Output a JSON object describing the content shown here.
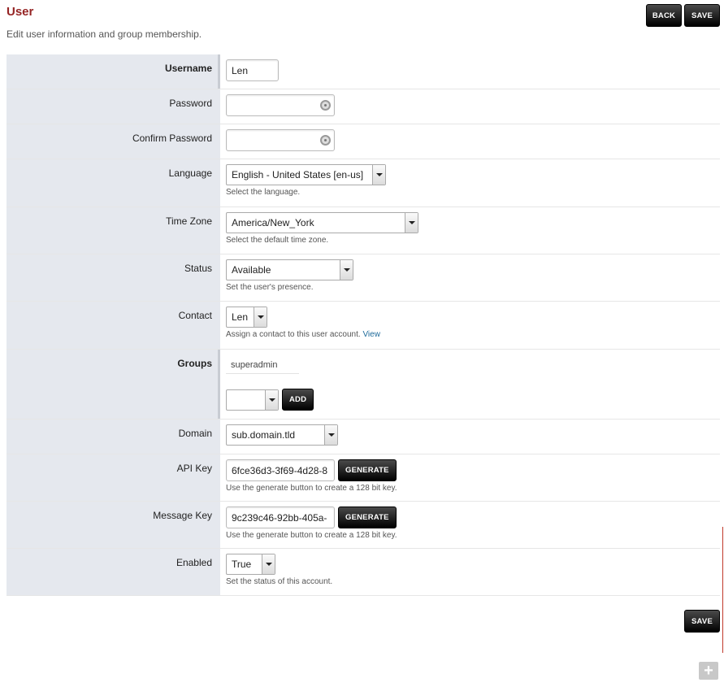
{
  "page": {
    "title": "User",
    "description": "Edit user information and group membership."
  },
  "buttons": {
    "back": "BACK",
    "save": "SAVE",
    "generate": "GENERATE",
    "add": "ADD"
  },
  "form": {
    "username": {
      "label": "Username",
      "value": "Len"
    },
    "password": {
      "label": "Password",
      "value": ""
    },
    "confirm_password": {
      "label": "Confirm Password",
      "value": ""
    },
    "language": {
      "label": "Language",
      "value": "English - United States [en-us]",
      "hint": "Select the language."
    },
    "time_zone": {
      "label": "Time Zone",
      "value": "America/New_York",
      "hint": "Select the default time zone."
    },
    "status": {
      "label": "Status",
      "value": "Available",
      "hint": "Set the user's presence."
    },
    "contact": {
      "label": "Contact",
      "value": "Len",
      "hint": "Assign a contact to this user account.",
      "link": "View"
    },
    "groups": {
      "label": "Groups",
      "items": [
        "superadmin"
      ],
      "select_value": ""
    },
    "domain": {
      "label": "Domain",
      "value": "sub.domain.tld"
    },
    "api_key": {
      "label": "API Key",
      "value": "6fce36d3-3f69-4d28-8",
      "hint": "Use the generate button to create a 128 bit key."
    },
    "message_key": {
      "label": "Message Key",
      "value": "9c239c46-92bb-405a-",
      "hint": "Use the generate button to create a 128 bit key."
    },
    "enabled": {
      "label": "Enabled",
      "value": "True",
      "hint": "Set the status of this account."
    }
  },
  "colors": {
    "title": "#952424",
    "label_bg": "#e5e8ee",
    "button_bg": "#000000",
    "link": "#1d6a9a"
  },
  "icons": {
    "password_toggle": "eye-icon",
    "select_arrow": "chevron-down-icon",
    "add_corner": "plus-icon"
  }
}
